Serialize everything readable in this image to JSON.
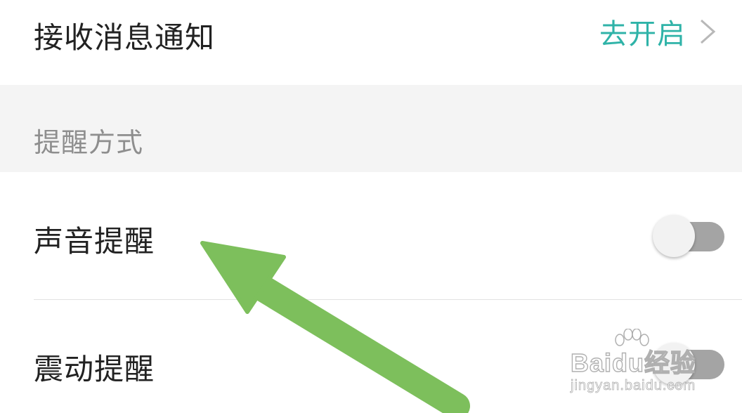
{
  "notification": {
    "label": "接收消息通知",
    "action_label": "去开启",
    "icon": "chevron-right-icon"
  },
  "reminder_section": {
    "title": "提醒方式"
  },
  "sound_reminder": {
    "label": "声音提醒",
    "enabled": false
  },
  "vibrate_reminder": {
    "label": "震动提醒",
    "enabled": false
  },
  "watermark": {
    "logo_text": "Baidu经验",
    "url_text": "jingyan.baidu.com"
  },
  "colors": {
    "accent": "#2fb3a8",
    "arrow": "#7dbf5c",
    "section_bg": "#f4f4f4",
    "toggle_track": "#a4a4a4"
  }
}
